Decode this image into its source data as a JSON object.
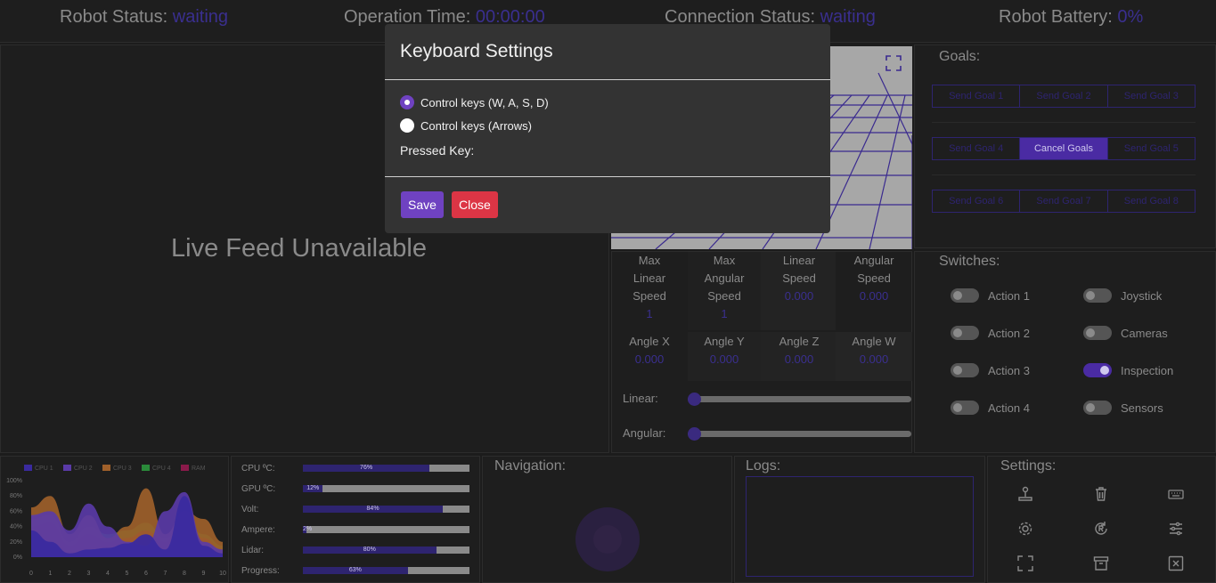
{
  "topbar": {
    "robot_status_label": "Robot Status:",
    "robot_status_value": "waiting",
    "operation_time_label": "Operation Time:",
    "operation_time_value": "00:00:00",
    "connection_status_label": "Connection Status:",
    "connection_status_value": "waiting",
    "battery_label": "Robot Battery:",
    "battery_value": "0%"
  },
  "live_feed": {
    "message": "Live Feed Unavailable"
  },
  "goals": {
    "title": "Goals:",
    "rows": [
      [
        "Send Goal 1",
        "Send Goal 2",
        "Send Goal 3"
      ],
      [
        "Send Goal 4",
        "Cancel Goals",
        "Send Goal 5"
      ],
      [
        "Send Goal 6",
        "Send Goal 7",
        "Send Goal 8"
      ]
    ]
  },
  "speeds": {
    "max_linear_label": "Max Linear Speed",
    "max_linear_value": "1",
    "max_angular_label": "Max Angular Speed",
    "max_angular_value": "1",
    "linear_label": "Linear Speed",
    "linear_value": "0.000",
    "angular_label": "Angular Speed",
    "angular_value": "0.000",
    "angle_x_label": "Angle X",
    "angle_x_value": "0.000",
    "angle_y_label": "Angle Y",
    "angle_y_value": "0.000",
    "angle_z_label": "Angle Z",
    "angle_z_value": "0.000",
    "angle_w_label": "Angle W",
    "angle_w_value": "0.000",
    "linear_slider_label": "Linear:",
    "angular_slider_label": "Angular:",
    "linear_slider_level": 0,
    "angular_slider_level": 0
  },
  "switches": {
    "title": "Switches:",
    "items": [
      {
        "label": "Action 1",
        "on": false
      },
      {
        "label": "Joystick",
        "on": false
      },
      {
        "label": "Action 2",
        "on": false
      },
      {
        "label": "Cameras",
        "on": false
      },
      {
        "label": "Action 3",
        "on": false
      },
      {
        "label": "Inspection",
        "on": true
      },
      {
        "label": "Action 4",
        "on": false
      },
      {
        "label": "Sensors",
        "on": false
      }
    ]
  },
  "chart_data": {
    "type": "area",
    "x": [
      0,
      1,
      2,
      3,
      4,
      5,
      6,
      7,
      8,
      9,
      10
    ],
    "ylim": [
      0,
      100
    ],
    "y_ticks": [
      "0%",
      "20%",
      "40%",
      "60%",
      "80%",
      "100%"
    ],
    "series": [
      {
        "name": "CPU 1",
        "color": "#3a2a9f",
        "values": [
          35,
          20,
          5,
          10,
          12,
          18,
          30,
          10,
          80,
          15,
          5
        ]
      },
      {
        "name": "CPU 2",
        "color": "#5a3aa8",
        "values": [
          55,
          60,
          35,
          70,
          40,
          20,
          15,
          60,
          85,
          20,
          10
        ]
      },
      {
        "name": "CPU 3",
        "color": "#a0602a",
        "values": [
          65,
          80,
          30,
          55,
          25,
          40,
          90,
          30,
          60,
          50,
          20
        ]
      },
      {
        "name": "CPU 4",
        "color": "#2a8a3a",
        "values": [
          50,
          55,
          20,
          40,
          30,
          35,
          45,
          25,
          50,
          30,
          15
        ]
      },
      {
        "name": "RAM",
        "color": "#8a1a4a",
        "values": [
          40,
          45,
          15,
          30,
          20,
          25,
          35,
          20,
          45,
          25,
          10
        ]
      }
    ]
  },
  "stats": [
    {
      "label": "CPU ºC:",
      "text": "76%",
      "value": 76
    },
    {
      "label": "GPU ºC:",
      "text": "12%",
      "value": 12
    },
    {
      "label": "Volt:",
      "text": "84%",
      "value": 84
    },
    {
      "label": "Ampere:",
      "text": "2%",
      "value": 2
    },
    {
      "label": "Lidar:",
      "text": "80%",
      "value": 80
    },
    {
      "label": "Progress:",
      "text": "63%",
      "value": 63
    }
  ],
  "navigation": {
    "title": "Navigation:"
  },
  "logs": {
    "title": "Logs:"
  },
  "settings": {
    "title": "Settings:",
    "icons": [
      "joystick-icon",
      "trash-icon",
      "keyboard-icon",
      "gear-icon",
      "restart-icon",
      "sliders-icon",
      "fullscreen-icon",
      "archive-icon",
      "close-box-icon"
    ]
  },
  "modal": {
    "title": "Keyboard Settings",
    "option_wasd": "Control keys (W, A, S, D)",
    "option_arrows": "Control keys (Arrows)",
    "selected": "wasd",
    "pressed_key_label": "Pressed Key:",
    "save_label": "Save",
    "close_label": "Close"
  },
  "colors": {
    "accent": "#3a2f8f",
    "primary": "#6f42c1",
    "danger": "#dc3545"
  }
}
